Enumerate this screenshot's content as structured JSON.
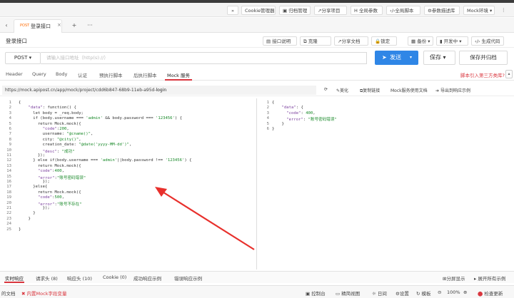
{
  "toolbar": {
    "items": [
      "»",
      "Cookie管理器",
      "归档管理",
      "分享项目",
      "全局参数",
      "全局脚本",
      "参数描述库",
      "Mock环境 ▾"
    ],
    "more": "⋮"
  },
  "tabs": {
    "method": "POST",
    "name": "登录接口",
    "close": "×",
    "add": "+",
    "more": "···",
    "back": "‹"
  },
  "path": {
    "title": "登录接口",
    "actions": [
      "接口说明",
      "克隆",
      "分享文档",
      "锁定",
      "备份 ▾",
      "开发中 ▾",
      "生成代码"
    ]
  },
  "url": {
    "method": "POST ▾",
    "placeholder": "请输入接口地址（http(s)://）",
    "send": "发送",
    "send_caret": "▾",
    "save": "保存 ▾",
    "save_run": "保存并归档"
  },
  "request_tabs": [
    "Header",
    "Query",
    "Body",
    "认证",
    "预执行脚本",
    "后执行脚本",
    "Mock 服务"
  ],
  "request_tabs_active": "Mock 服务",
  "script_link": "脚本引入第三方类库?",
  "mock": {
    "url_prefix": "https://mock.apipost.cn/app/mock/project/cdd6b847-68b9-11eb-a95d-",
    "url_suffix": "login",
    "actions": [
      "美化",
      "复制链接",
      "Mock服务使用文档",
      "导出到响应示例"
    ]
  },
  "left_code": [
    {
      "n": "1",
      "text": "{"
    },
    {
      "n": "2",
      "text": "    \"data\": function() {"
    },
    {
      "n": "3",
      "text": "      let body = _req.body;"
    },
    {
      "n": "4",
      "text": "      if (body.username === 'admin' && body.password === '123456') {"
    },
    {
      "n": "5",
      "text": "        return Mock.mock({"
    },
    {
      "n": "6",
      "text": "          \"code\":200,"
    },
    {
      "n": "7",
      "text": "          username: \"@cname()\","
    },
    {
      "n": "8",
      "text": "          city: \"@city()\","
    },
    {
      "n": "9",
      "text": "          creation_date: \"@date('yyyy-MM-dd')\","
    },
    {
      "n": "10",
      "text": "          \"desc\": \"成功\""
    },
    {
      "n": "11",
      "text": "        });"
    },
    {
      "n": "12",
      "text": "      } else if(body.username === 'admin'||body.password !== '123456') {"
    },
    {
      "n": "13",
      "text": "        return Mock.mock({"
    },
    {
      "n": "14",
      "text": "        \"code\":400,"
    },
    {
      "n": "15",
      "text": "        \"error\":\"账号密码错误\""
    },
    {
      "n": "16",
      "text": "          });"
    },
    {
      "n": "17",
      "text": "      }else{"
    },
    {
      "n": "18",
      "text": "        return Mock.mock({"
    },
    {
      "n": "19",
      "text": "        \"code\":500,"
    },
    {
      "n": "20",
      "text": "        \"error\":\"账号不存在\""
    },
    {
      "n": "21",
      "text": "          });"
    },
    {
      "n": "22",
      "text": "      }"
    },
    {
      "n": "23",
      "text": "    }"
    },
    {
      "n": "24",
      "text": ""
    },
    {
      "n": "25",
      "text": "}"
    }
  ],
  "right_code": [
    {
      "n": "1",
      "text": "{"
    },
    {
      "n": "2",
      "text": "    \"data\": {"
    },
    {
      "n": "3",
      "text": "      \"code\": 400,"
    },
    {
      "n": "4",
      "text": "      \"error\": \"账号密码错误\""
    },
    {
      "n": "5",
      "text": "    }"
    },
    {
      "n": "6",
      "text": "}"
    }
  ],
  "bottom_tabs": [
    "实时响应",
    "请求头 (8)",
    "响应头 (10)",
    "Cookie (0)",
    "成功响应示例",
    "错误响应示例"
  ],
  "bottom_right": [
    "分屏显示",
    "展开所有示例"
  ],
  "status": {
    "left": [
      "的文档",
      "内置Mock字段变量"
    ],
    "right": [
      "控制台",
      "精简视图",
      "日间",
      "设置",
      "模板",
      "100%",
      "检查更新"
    ]
  },
  "colors": {
    "accent": "#2f86e6",
    "danger": "#d9363e",
    "method": "#ff6a00"
  }
}
